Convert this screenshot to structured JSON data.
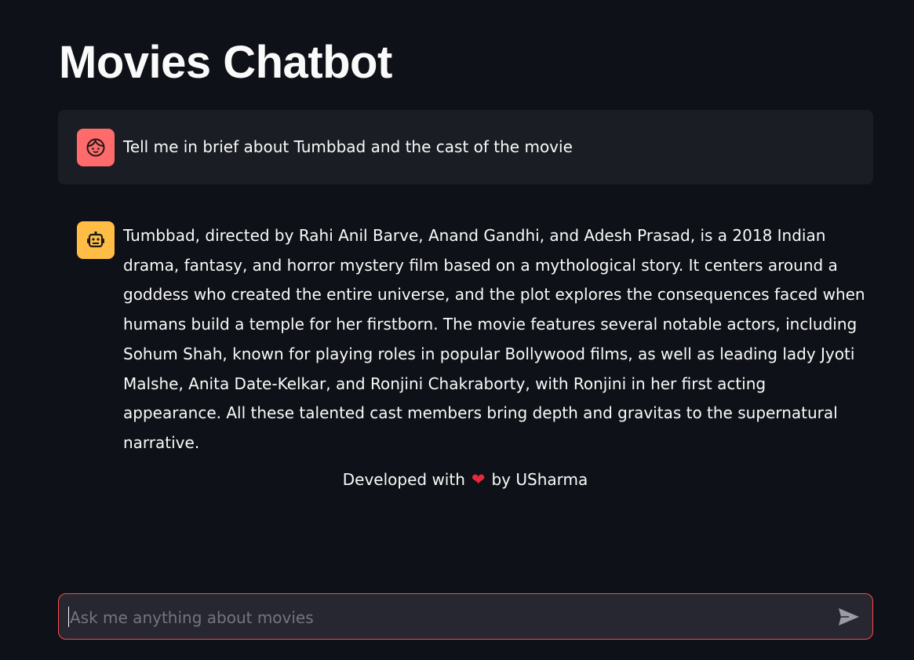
{
  "app": {
    "title": "Movies Chatbot"
  },
  "messages": [
    {
      "role": "user",
      "avatar_icon": "face-icon",
      "avatar_color": "#ff6b6b",
      "text": "Tell me in brief about Tumbbad and the cast of the movie"
    },
    {
      "role": "assistant",
      "avatar_icon": "robot-icon",
      "avatar_color": "#ffbd45",
      "text": "Tumbbad, directed by Rahi Anil Barve, Anand Gandhi, and Adesh Prasad, is a 2018 Indian drama, fantasy, and horror mystery film based on a mythological story. It centers around a goddess who created the entire universe, and the plot explores the consequences faced when humans build a temple for her firstborn. The movie features several notable actors, including Sohum Shah, known for playing roles in popular Bollywood films, as well as leading lady Jyoti Malshe, Anita Date-Kelkar, and Ronjini Chakraborty, with Ronjini in her first acting appearance. All these talented cast members bring depth and gravitas to the supernatural narrative."
    }
  ],
  "footer": {
    "prefix": "Developed with",
    "heart": "❤",
    "suffix": "by USharma"
  },
  "chat_input": {
    "placeholder": "Ask me anything about movies",
    "value": "",
    "border_color": "#ff4b4b",
    "send_icon": "send-icon"
  },
  "colors": {
    "background": "#0e1117",
    "user_bubble": "#1a1d24",
    "input_background": "#262730",
    "heart": "#e8283a"
  }
}
